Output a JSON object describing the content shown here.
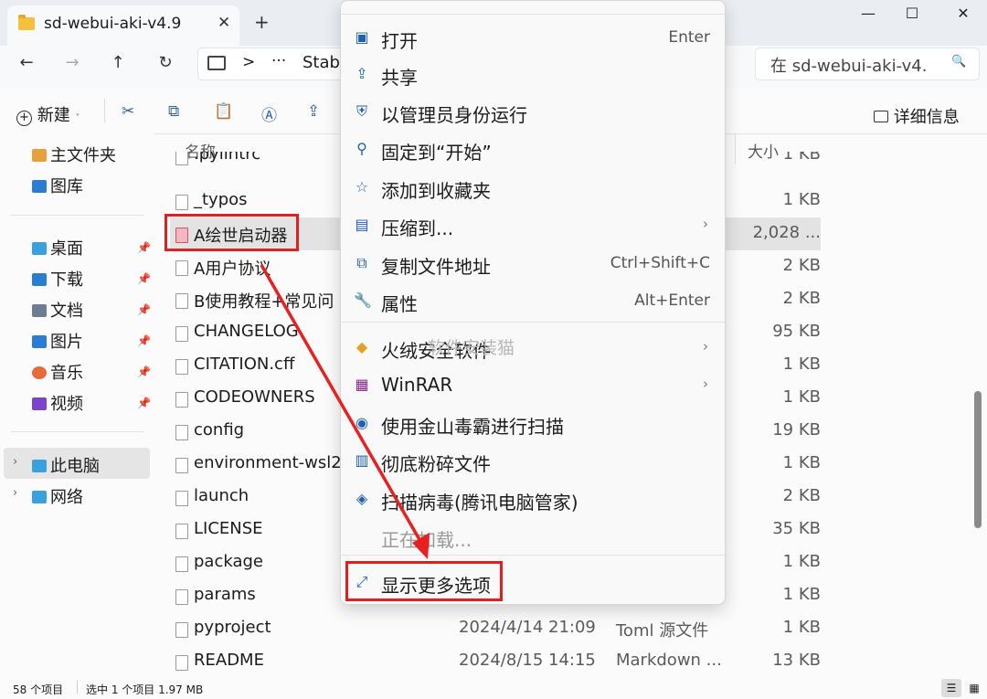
{
  "window": {
    "tab_title": "sd-webui-aki-v4.9",
    "tab_close": "✕",
    "new_tab": "+",
    "minimize": "—",
    "maximize": "☐",
    "close": "✕"
  },
  "nav": {
    "back": "←",
    "forward": "→",
    "up": "↑",
    "refresh": "↻",
    "address_sep": ">",
    "address_more": "···",
    "address_text": "Stab",
    "search_placeholder": "在 sd-webui-aki-v4.",
    "search_icon": "🔍"
  },
  "toolbar": {
    "new_label": "新建",
    "details_label": "详细信息"
  },
  "sidebar": {
    "items": [
      {
        "label": "主文件夹",
        "icon": "home-icon",
        "color": "#e8a13a"
      },
      {
        "label": "图库",
        "icon": "gallery-icon",
        "color": "#2b7cd3"
      },
      {
        "label": "桌面",
        "icon": "desktop-icon",
        "color": "#3aa0e0"
      },
      {
        "label": "下载",
        "icon": "download-icon",
        "color": "#2b7cd3"
      },
      {
        "label": "文档",
        "icon": "document-icon",
        "color": "#6b7d93"
      },
      {
        "label": "图片",
        "icon": "pictures-icon",
        "color": "#2b7cd3"
      },
      {
        "label": "音乐",
        "icon": "music-icon",
        "color": "#e86a3a"
      },
      {
        "label": "视频",
        "icon": "video-icon",
        "color": "#7a45c8"
      },
      {
        "label": "此电脑",
        "icon": "computer-icon",
        "color": "#3aa0e0"
      },
      {
        "label": "网络",
        "icon": "network-icon",
        "color": "#3aa0e0"
      }
    ]
  },
  "filelist": {
    "headers": {
      "name": "名称",
      "size": "大小"
    },
    "rows": [
      {
        "name": ".pylintrc",
        "date": "",
        "type": "",
        "size": "1 KB"
      },
      {
        "name": "_typos",
        "date": "",
        "type": "",
        "size": "1 KB"
      },
      {
        "name": "A绘世启动器",
        "date": "",
        "type": "",
        "size": "2,028 ..."
      },
      {
        "name": "A用户协议",
        "date": "",
        "type": "",
        "size": "2 KB"
      },
      {
        "name": "B使用教程+常见问",
        "date": "",
        "type": "",
        "size": "2 KB"
      },
      {
        "name": "CHANGELOG",
        "date": "",
        "type": "",
        "size": "95 KB"
      },
      {
        "name": "CITATION.cff",
        "date": "",
        "type": "",
        "size": "1 KB"
      },
      {
        "name": "CODEOWNERS",
        "date": "",
        "type": "",
        "size": "1 KB"
      },
      {
        "name": "config",
        "date": "",
        "type": "",
        "size": "19 KB"
      },
      {
        "name": "environment-wsl2",
        "date": "",
        "type": "",
        "size": "1 KB"
      },
      {
        "name": "launch",
        "date": "",
        "type": "",
        "size": "2 KB"
      },
      {
        "name": "LICENSE",
        "date": "",
        "type": "",
        "size": "35 KB"
      },
      {
        "name": "package",
        "date": "",
        "type": "",
        "size": "1 KB"
      },
      {
        "name": "params",
        "date": "",
        "type": "",
        "size": "1 KB"
      },
      {
        "name": "pyproject",
        "date": "2024/4/14 21:09",
        "type": "Toml 源文件",
        "size": "1 KB"
      },
      {
        "name": "README",
        "date": "2024/8/15 14:15",
        "type": "Markdown ...",
        "size": "13 KB"
      }
    ]
  },
  "status": {
    "count": "58 个项目",
    "selection": "选中 1 个项目 1.97 MB"
  },
  "menu": {
    "items": [
      {
        "label": "打开",
        "shortcut": "Enter",
        "icon": "open-icon"
      },
      {
        "label": "共享",
        "shortcut": "",
        "icon": "share-icon"
      },
      {
        "label": "以管理员身份运行",
        "shortcut": "",
        "icon": "shield-icon"
      },
      {
        "label": "固定到“开始”",
        "shortcut": "",
        "icon": "pin-icon"
      },
      {
        "label": "添加到收藏夹",
        "shortcut": "",
        "icon": "star-icon"
      },
      {
        "label": "压缩到...",
        "shortcut": "",
        "icon": "zip-icon",
        "arrow": "›"
      },
      {
        "label": "复制文件地址",
        "shortcut": "Ctrl+Shift+C",
        "icon": "copy-path-icon"
      },
      {
        "label": "属性",
        "shortcut": "Alt+Enter",
        "icon": "wrench-icon"
      },
      {
        "label": "火绒安全软件",
        "shortcut": "",
        "icon": "huorong-icon",
        "arrow": "›"
      },
      {
        "label": "WinRAR",
        "shortcut": "",
        "icon": "winrar-icon",
        "arrow": "›"
      },
      {
        "label": "使用金山毒霸进行扫描",
        "shortcut": "",
        "icon": "kingsoft-icon"
      },
      {
        "label": "彻底粉碎文件",
        "shortcut": "",
        "icon": "shred-icon"
      },
      {
        "label": "扫描病毒(腾讯电脑管家)",
        "shortcut": "",
        "icon": "tencent-icon"
      },
      {
        "label": "正在加载...",
        "shortcut": "",
        "icon": ""
      },
      {
        "label": "显示更多选项",
        "shortcut": "",
        "icon": "more-options-icon"
      }
    ]
  },
  "watermark": "软件安装猫",
  "colors": {
    "highlight": "#e02020",
    "accent": "#1f5fb4"
  }
}
